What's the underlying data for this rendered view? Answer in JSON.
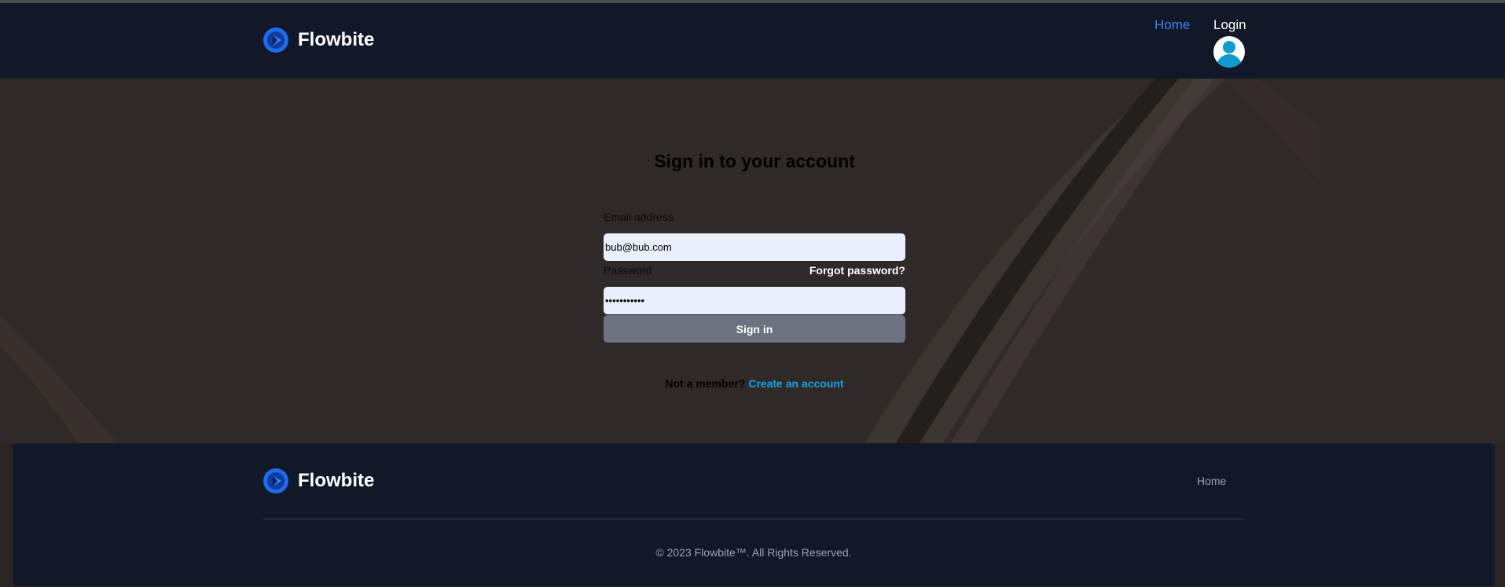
{
  "header": {
    "brand": "Flowbite",
    "nav_home": "Home",
    "nav_login": "Login"
  },
  "signin": {
    "title": "Sign in to your account",
    "email_label": "Email address",
    "email_value": "bub@bub.com",
    "password_label": "Password",
    "forgot_link": "Forgot password?",
    "password_value": "•••••••••••",
    "submit_label": "Sign in",
    "not_member": "Not a member?",
    "create_account": "Create an account"
  },
  "footer": {
    "brand": "Flowbite",
    "home_link": "Home",
    "copyright": "© 2023 Flowbite™. All Rights Reserved."
  },
  "colors": {
    "nav_bg": "#111827",
    "link_active": "#3b82f6",
    "link_accent": "#0ea5e9",
    "button_bg": "#6b7280",
    "input_bg": "#e8f0fe"
  },
  "icons": {
    "brand_logo": "flowbite-logo-icon",
    "user_avatar": "user-avatar-icon"
  }
}
